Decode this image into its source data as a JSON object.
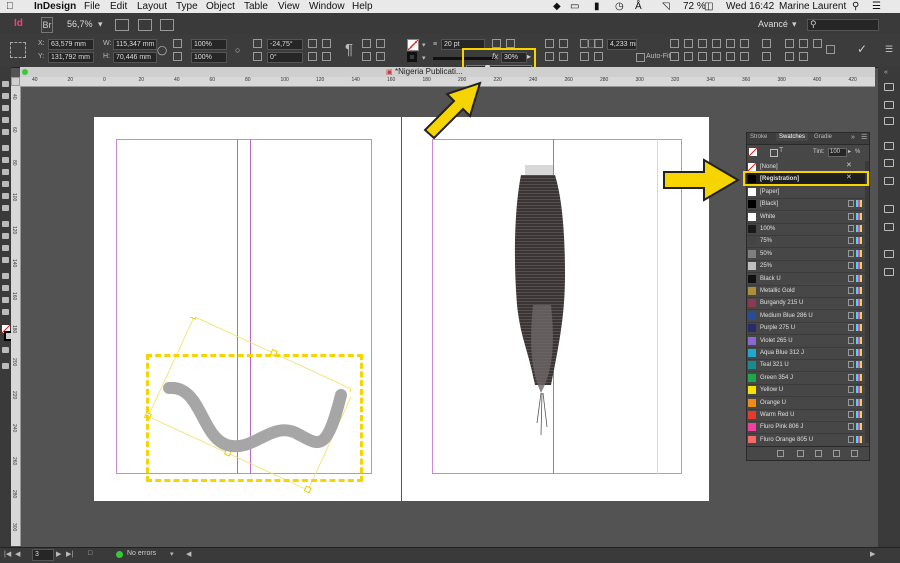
{
  "menubar": {
    "app_name": "InDesign",
    "items": [
      "File",
      "Edit",
      "Layout",
      "Type",
      "Object",
      "Table",
      "View",
      "Window",
      "Help"
    ],
    "battery": "72 %",
    "clock": "Wed 16:42",
    "user": "Marine Laurent"
  },
  "appbar": {
    "logo": "Id",
    "br": "Br",
    "zoom": "56,7%",
    "workspace": "Avancé"
  },
  "control": {
    "x_label": "X:",
    "x_value": "63,579 mm",
    "y_label": "Y:",
    "y_value": "131,792 mm",
    "w_label": "W:",
    "w_value": "115,347 mm",
    "h_label": "H:",
    "h_value": "70,446 mm",
    "scale_x": "100%",
    "scale_y": "100%",
    "rotation": "-24,75°",
    "shear": "0°",
    "stroke_weight": "20 pt",
    "opacity": "30%",
    "measure": "4,233 mm",
    "autofit": "Auto-Fit"
  },
  "doc_tab": {
    "title": "*Nigeria Publicati..."
  },
  "ruler": {
    "h_ticks": [
      "40",
      "20",
      "0",
      "20",
      "40",
      "60",
      "80",
      "100",
      "120",
      "140",
      "160",
      "180",
      "200",
      "220",
      "240",
      "260",
      "280",
      "300",
      "320",
      "340",
      "360",
      "380",
      "400",
      "420"
    ],
    "v_ticks": [
      "40",
      "60",
      "80",
      "100",
      "120",
      "140",
      "160",
      "180",
      "200",
      "220",
      "240",
      "260",
      "280",
      "300"
    ]
  },
  "swatches_panel": {
    "tabs": [
      "Stroke",
      "Swatches",
      "Gradie"
    ],
    "tint_label": "Tint:",
    "tint_value": "100",
    "tint_unit": "%",
    "swatches": [
      {
        "name": "[None]",
        "color": "#ffffff"
      },
      {
        "name": "[Registration]",
        "color": "#000000"
      },
      {
        "name": "[Paper]",
        "color": "#ffffff"
      },
      {
        "name": "[Black]",
        "color": "#000000"
      },
      {
        "name": "White",
        "color": "#ffffff"
      },
      {
        "name": "100%",
        "color": "#1a1a1a"
      },
      {
        "name": "75%",
        "color": "#444444"
      },
      {
        "name": "50%",
        "color": "#7f7f7f"
      },
      {
        "name": "25%",
        "color": "#bfbfbf"
      },
      {
        "name": "Black U",
        "color": "#111111"
      },
      {
        "name": "Metallic Gold",
        "color": "#b08d3a"
      },
      {
        "name": "Burgandy 215 U",
        "color": "#8b3a52"
      },
      {
        "name": "Medium Blue 286 U",
        "color": "#2a4a9a"
      },
      {
        "name": "Purple 275 U",
        "color": "#2a2a6a"
      },
      {
        "name": "Violet 265 U",
        "color": "#8a6ad0"
      },
      {
        "name": "Aqua Blue 312 J",
        "color": "#22a8cc"
      },
      {
        "name": "Teal 321 U",
        "color": "#1a8a8a"
      },
      {
        "name": "Green 354 J",
        "color": "#1fa84a"
      },
      {
        "name": "Yellow U",
        "color": "#f5e000"
      },
      {
        "name": "Orange U",
        "color": "#f08a1a"
      },
      {
        "name": "Warm Red U",
        "color": "#e83a2a"
      },
      {
        "name": "Fluro Pink 806 J",
        "color": "#f040a0"
      },
      {
        "name": "Fluro Orange 805 U",
        "color": "#f86a6a"
      }
    ]
  },
  "status": {
    "page": "3",
    "errors": "No errors"
  }
}
